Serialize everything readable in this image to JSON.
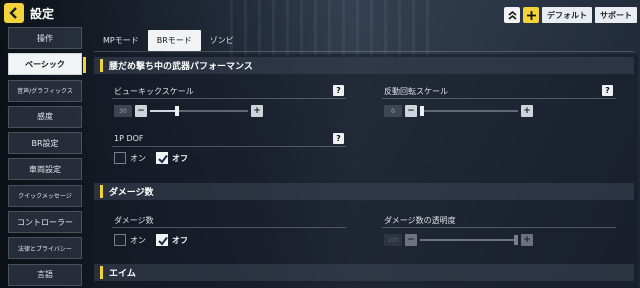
{
  "header": {
    "title": "設定",
    "default_label": "デフォルト",
    "support_label": "サポート"
  },
  "sidebar": {
    "items": [
      {
        "label": "操作"
      },
      {
        "label": "ベーシック"
      },
      {
        "label": "音声/グラフィックス"
      },
      {
        "label": "感度"
      },
      {
        "label": "BR設定"
      },
      {
        "label": "車両設定"
      },
      {
        "label": "クイックメッセージ"
      },
      {
        "label": "コントローラー"
      },
      {
        "label": "法律とプライバシー"
      },
      {
        "label": "言語"
      }
    ],
    "active_index": 1
  },
  "tabs": [
    {
      "label": "MPモード"
    },
    {
      "label": "BRモード"
    },
    {
      "label": "ゾンビ"
    }
  ],
  "sections": {
    "hipfire": {
      "title": "腰だめ撃ち中の武器パフォーマンス",
      "view_kick": {
        "label": "ビューキックスケール",
        "value": "30",
        "level": 0.27
      },
      "recoil_rotation": {
        "label": "反動回転スケール",
        "value": "0",
        "level": 0.0
      },
      "dof": {
        "label": "1P DOF",
        "on_label": "オン",
        "off_label": "オフ",
        "selected": "off"
      }
    },
    "damage": {
      "title": "ダメージ数",
      "damage_numbers": {
        "label": "ダメージ数",
        "on_label": "オン",
        "off_label": "オフ",
        "selected": "off"
      },
      "opacity": {
        "label": "ダメージ数の透明度",
        "value": "100",
        "level": 1.0
      }
    },
    "aim": {
      "title": "エイム"
    }
  },
  "help_label": "?",
  "minus_label": "−",
  "plus_label": "+",
  "colors": {
    "accent": "#f2d43a",
    "panel": "#1b2430"
  }
}
